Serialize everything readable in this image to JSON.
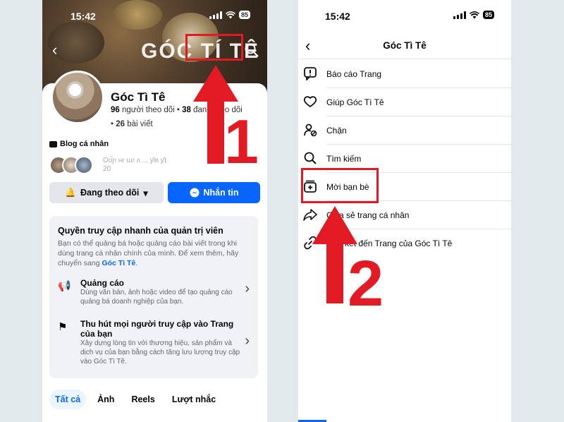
{
  "status": {
    "time": "15:42",
    "battery": "85"
  },
  "left": {
    "cover_title": "GÓC TÍ TÊ",
    "page_name": "Góc Tì Tê",
    "followers_count": "96",
    "followers_label": "người theo dõi",
    "following_count": "38",
    "following_label": "đang theo dõi",
    "posts_count": "26",
    "posts_label": "bài viết",
    "category": "Blog cá nhân",
    "mutual_text_line1": "Oʊ̃ɲ ʜɾ ɯɾ ʌ ... ƴʍ ƴɪ",
    "mutual_text_line2": "20",
    "follow_button": "Đang theo dõi",
    "message_button": "Nhắn tin",
    "admin": {
      "title": "Quyền truy cập nhanh của quản trị viên",
      "desc_prefix": "Bạn có thể quảng bá hoặc quảng cáo bài viết trong khi dùng trang cá nhân chính của mình. Để xem thêm, hãy chuyển sang ",
      "desc_link": "Góc Tì Tê",
      "desc_suffix": ".",
      "ads_title": "Quảng cáo",
      "ads_desc": "Dùng văn bản, ảnh hoặc video để tạo quảng cáo quảng bá doanh nghiệp của bạn.",
      "attract_title": "Thu hút mọi người truy cập vào Trang của bạn",
      "attract_desc": "Xây dựng lòng tin với thương hiệu, sản phẩm và dịch vụ của bạn bằng cách tăng lưu lượng truy cập vào Góc Tì Tê."
    },
    "tabs": [
      "Tất cả",
      "Ảnh",
      "Reels",
      "Lượt nhắc"
    ]
  },
  "right": {
    "title": "Góc Tì Tê",
    "menu": [
      {
        "label": "Báo cáo Trang",
        "icon": "report-icon"
      },
      {
        "label": "Giúp Góc Tì Tê",
        "icon": "heart-hands-icon"
      },
      {
        "label": "Chặn",
        "icon": "block-user-icon"
      },
      {
        "label": "Tìm kiếm",
        "icon": "search-icon"
      },
      {
        "label": "Mời bạn bè",
        "icon": "invite-icon"
      },
      {
        "label": "Chia sẻ trang cá nhân",
        "icon": "share-icon"
      },
      {
        "label": "Liên kết đến Trang của Góc Tì Tê",
        "icon": "link-icon"
      }
    ]
  },
  "annotations": {
    "step1": "1",
    "step2": "2",
    "color": "#e11a23"
  }
}
